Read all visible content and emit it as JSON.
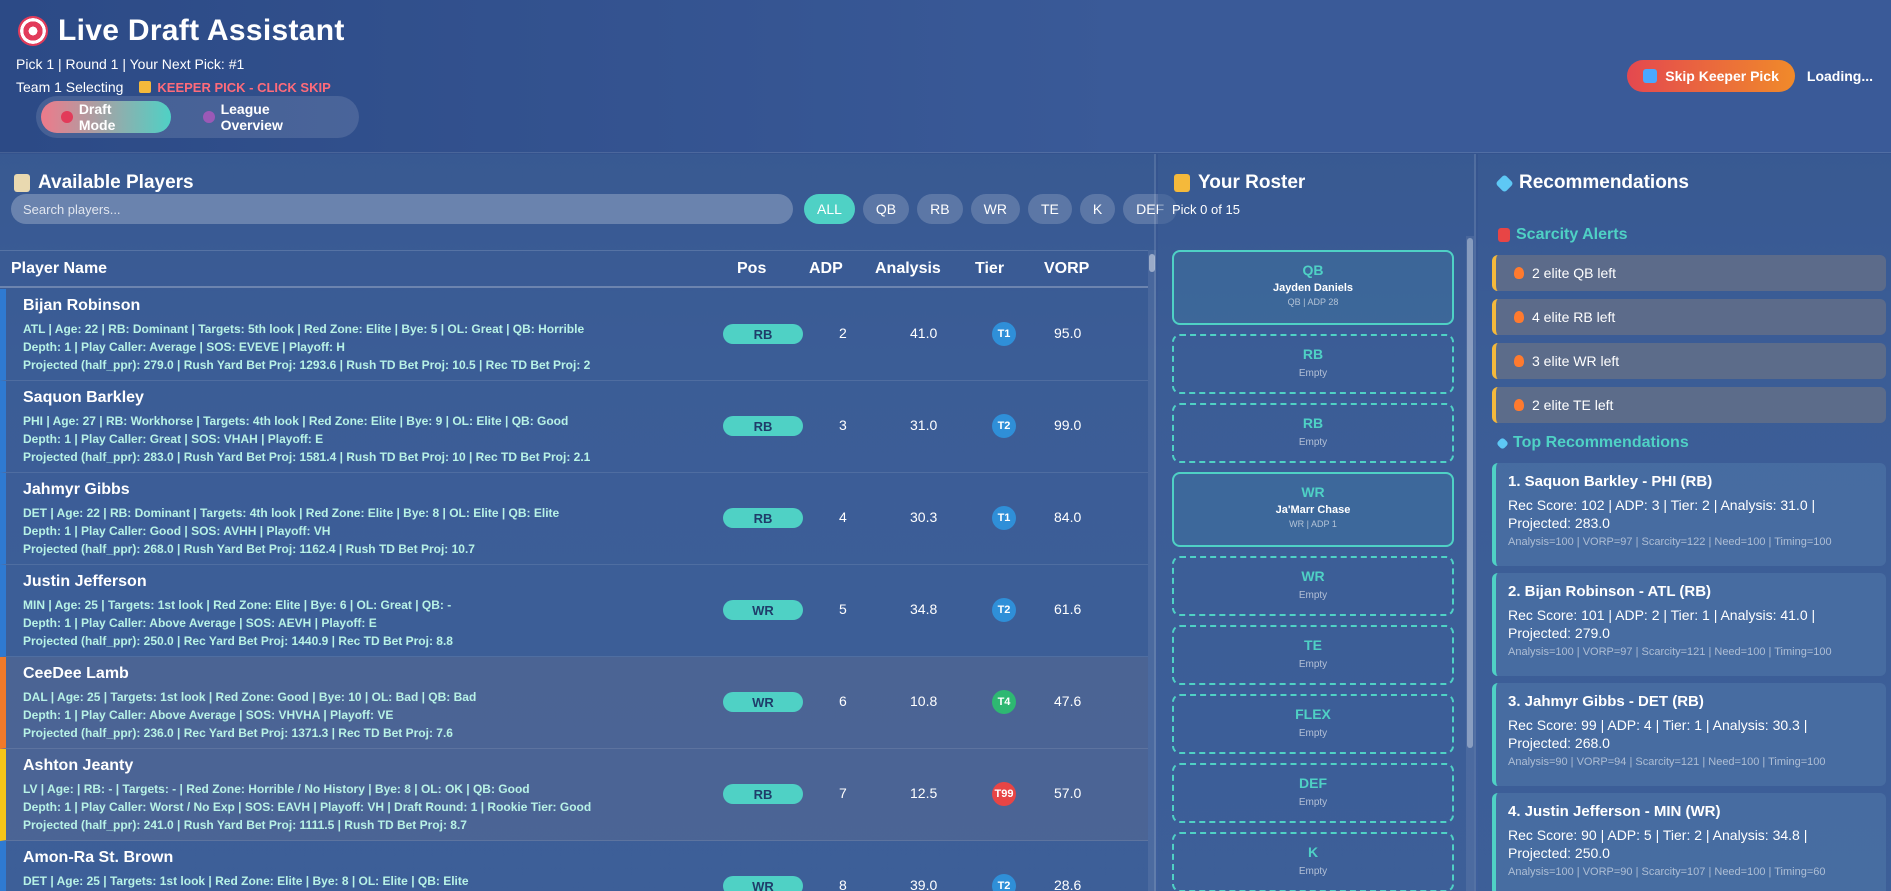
{
  "header": {
    "title": "Live Draft Assistant",
    "pick_info": "Pick 1 | Round 1 | Your Next Pick: #1",
    "team_selecting": "Team 1 Selecting",
    "keeper_warning": "KEEPER PICK - CLICK SKIP",
    "modes": [
      "Draft Mode",
      "League Overview"
    ],
    "skip_button": "Skip Keeper Pick",
    "loading": "Loading..."
  },
  "available": {
    "title": "Available Players",
    "search_placeholder": "Search players...",
    "filters": [
      "ALL",
      "QB",
      "RB",
      "WR",
      "TE",
      "K",
      "DEF"
    ],
    "columns": [
      "Player Name",
      "Pos",
      "ADP",
      "Analysis",
      "Tier",
      "VORP"
    ],
    "players": [
      {
        "name": "Bijan Robinson",
        "line1": "ATL | Age: 22 | RB: Dominant | Targets: 5th look | Red Zone: Elite | Bye: 5 | OL: Great | QB: Horrible",
        "line2": "Depth: 1 | Play Caller: Average | SOS: EVEVE | Playoff: H",
        "line3": "Projected (half_ppr): 279.0 | Rush Yard Bet Proj: 1293.6 | Rush TD Bet Proj: 10.5 | Rec TD Bet Proj: 2",
        "pos": "RB",
        "adp": "2",
        "analysis": "41.0",
        "tier": "T1",
        "vorp": "95.0",
        "tier_color": "#2f8fd8",
        "flag_color": "#2f7ad1"
      },
      {
        "name": "Saquon Barkley",
        "line1": "PHI | Age: 27 | RB: Workhorse | Targets: 4th look | Red Zone: Elite | Bye: 9 | OL: Elite | QB: Good",
        "line2": "Depth: 1 | Play Caller: Great | SOS: VHAH | Playoff: E",
        "line3": "Projected (half_ppr): 283.0 | Rush Yard Bet Proj: 1581.4 | Rush TD Bet Proj: 10 | Rec TD Bet Proj: 2.1",
        "pos": "RB",
        "adp": "3",
        "analysis": "31.0",
        "tier": "T2",
        "vorp": "99.0",
        "tier_color": "#2f8fd8",
        "flag_color": "#2f7ad1"
      },
      {
        "name": "Jahmyr Gibbs",
        "line1": "DET | Age: 22 | RB: Dominant | Targets: 4th look | Red Zone: Elite | Bye: 8 | OL: Elite | QB: Elite",
        "line2": "Depth: 1 | Play Caller: Good | SOS: AVHH | Playoff: VH",
        "line3": "Projected (half_ppr): 268.0 | Rush Yard Bet Proj: 1162.4 | Rush TD Bet Proj: 10.7",
        "pos": "RB",
        "adp": "4",
        "analysis": "30.3",
        "tier": "T1",
        "vorp": "84.0",
        "tier_color": "#2f8fd8",
        "flag_color": "#2f7ad1"
      },
      {
        "name": "Justin Jefferson",
        "line1": "MIN | Age: 25 | Targets: 1st look | Red Zone: Elite | Bye: 6 | OL: Great | QB: -",
        "line2": "Depth: 1 | Play Caller: Above Average | SOS: AEVH | Playoff: E",
        "line3": "Projected (half_ppr): 250.0 | Rec Yard Bet Proj: 1440.9 | Rec TD Bet Proj: 8.8",
        "pos": "WR",
        "adp": "5",
        "analysis": "34.8",
        "tier": "T2",
        "vorp": "61.6",
        "tier_color": "#2f8fd8",
        "flag_color": "#2f7ad1"
      },
      {
        "name": "CeeDee Lamb",
        "line1": "DAL | Age: 25 | Targets: 1st look | Red Zone: Good | Bye: 10 | OL: Bad | QB: Bad",
        "line2": "Depth: 1 | Play Caller: Above Average | SOS: VHVHA | Playoff: VE",
        "line3": "Projected (half_ppr): 236.0 | Rec Yard Bet Proj: 1371.3 | Rec TD Bet Proj: 7.6",
        "pos": "WR",
        "adp": "6",
        "analysis": "10.8",
        "tier": "T4",
        "vorp": "47.6",
        "tier_color": "#2eb872",
        "flag_color": "#f07a2a"
      },
      {
        "name": "Ashton Jeanty",
        "line1": "LV | Age: | RB: - | Targets: - | Red Zone: Horrible / No History | Bye: 8 | OL: OK | QB: Good",
        "line2": "Depth: 1 | Play Caller: Worst / No Exp | SOS: EAVH | Playoff: VH | Draft Round: 1 | Rookie Tier: Good",
        "line3": "Projected (half_ppr): 241.0 | Rush Yard Bet Proj: 1111.5 | Rush TD Bet Proj: 8.7",
        "pos": "RB",
        "adp": "7",
        "analysis": "12.5",
        "tier": "T99",
        "vorp": "57.0",
        "tier_color": "#e84545",
        "flag_color": "#f5c518"
      },
      {
        "name": "Amon-Ra St. Brown",
        "line1": "DET | Age: 25 | Targets: 1st look | Red Zone: Elite | Bye: 8 | OL: Elite | QB: Elite",
        "line2": "",
        "line3": "",
        "pos": "WR",
        "adp": "8",
        "analysis": "39.0",
        "tier": "T2",
        "vorp": "28.6",
        "tier_color": "#2f8fd8",
        "flag_color": "#2f7ad1"
      }
    ]
  },
  "roster": {
    "title": "Your Roster",
    "subtitle": "Pick 0 of 15",
    "slots": [
      {
        "pos": "QB",
        "name": "Jayden Daniels",
        "meta": "QB | ADP 28",
        "empty": ""
      },
      {
        "pos": "RB",
        "name": "",
        "meta": "",
        "empty": "Empty"
      },
      {
        "pos": "RB",
        "name": "",
        "meta": "",
        "empty": "Empty"
      },
      {
        "pos": "WR",
        "name": "Ja'Marr Chase",
        "meta": "WR | ADP 1",
        "empty": ""
      },
      {
        "pos": "WR",
        "name": "",
        "meta": "",
        "empty": "Empty"
      },
      {
        "pos": "TE",
        "name": "",
        "meta": "",
        "empty": "Empty"
      },
      {
        "pos": "FLEX",
        "name": "",
        "meta": "",
        "empty": "Empty"
      },
      {
        "pos": "DEF",
        "name": "",
        "meta": "",
        "empty": "Empty"
      },
      {
        "pos": "K",
        "name": "",
        "meta": "",
        "empty": "Empty"
      }
    ]
  },
  "recommendations": {
    "title": "Recommendations",
    "scarcity_title": "Scarcity Alerts",
    "alerts": [
      "2 elite QB left",
      "4 elite RB left",
      "3 elite WR left",
      "2 elite TE left"
    ],
    "top_title": "Top Recommendations",
    "items": [
      {
        "title": "1. Saquon Barkley - PHI (RB)",
        "desc": "Rec Score: 102 | ADP: 3 | Tier: 2 | Analysis: 31.0 | Projected: 283.0",
        "scores": "Analysis=100 | VORP=97 | Scarcity=122 | Need=100 | Timing=100"
      },
      {
        "title": "2. Bijan Robinson - ATL (RB)",
        "desc": "Rec Score: 101 | ADP: 2 | Tier: 1 | Analysis: 41.0 | Projected: 279.0",
        "scores": "Analysis=100 | VORP=97 | Scarcity=121 | Need=100 | Timing=100"
      },
      {
        "title": "3. Jahmyr Gibbs - DET (RB)",
        "desc": "Rec Score: 99 | ADP: 4 | Tier: 1 | Analysis: 30.3 | Projected: 268.0",
        "scores": "Analysis=90 | VORP=94 | Scarcity=121 | Need=100 | Timing=100"
      },
      {
        "title": "4. Justin Jefferson - MIN (WR)",
        "desc": "Rec Score: 90 | ADP: 5 | Tier: 2 | Analysis: 34.8 | Projected: 250.0",
        "scores": "Analysis=100 | VORP=90 | Scarcity=107 | Need=100 | Timing=60"
      }
    ]
  }
}
